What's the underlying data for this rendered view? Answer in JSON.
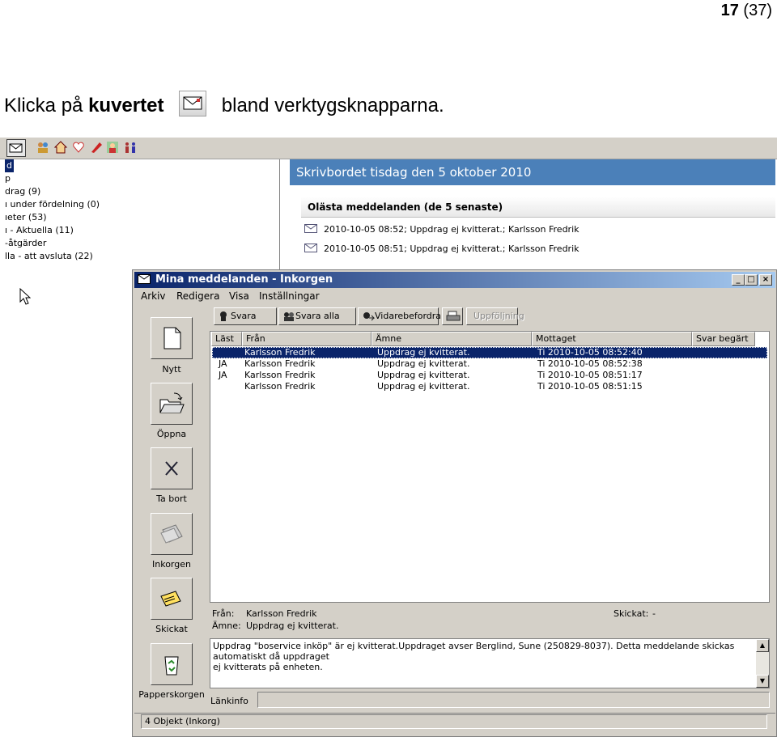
{
  "page": {
    "number": "17",
    "total": "37"
  },
  "instruction": {
    "prefix": "Klicka på",
    "bold": "kuvertet",
    "suffix": "bland verktygsknapparna."
  },
  "background_app": {
    "tree_items": [
      "d",
      "p",
      "drag (9)",
      "ı under fördelning (0)",
      "ıeter (53)",
      "ı - Aktuella (11)",
      "-åtgärder",
      "lla - att avsluta (22)"
    ],
    "desk_header": "Skrivbordet tisdag den 5 oktober 2010",
    "unread_title": "Olästa meddelanden (de 5 senaste)",
    "unread_items": [
      "2010-10-05 08:52; Uppdrag ej kvitterat.; Karlsson Fredrik",
      "2010-10-05 08:51; Uppdrag ej kvitterat.; Karlsson Fredrik"
    ]
  },
  "window": {
    "title": "Mina meddelanden - Inkorgen",
    "controls": [
      "_",
      "□",
      "×"
    ],
    "menu": [
      "Arkiv",
      "Redigera",
      "Visa",
      "Inställningar"
    ],
    "actions": {
      "reply": "Svara",
      "reply_all": "Svara alla",
      "forward": "Vidarebefordra",
      "followup": "Uppföljning"
    },
    "folders": {
      "new": "Nytt",
      "open": "Öppna",
      "delete": "Ta bort",
      "inbox": "Inkorgen",
      "sent": "Skickat",
      "trash": "Papperskorgen"
    },
    "columns": [
      "Läst",
      "Från",
      "Ämne",
      "Mottaget",
      "Svar begärt"
    ],
    "rows": [
      {
        "read": "",
        "from": "Karlsson Fredrik",
        "subject": "Uppdrag ej kvitterat.",
        "received": "Ti 2010-10-05 08:52:40",
        "reply": ""
      },
      {
        "read": "JA",
        "from": "Karlsson Fredrik",
        "subject": "Uppdrag ej kvitterat.",
        "received": "Ti 2010-10-05 08:52:38",
        "reply": ""
      },
      {
        "read": "JA",
        "from": "Karlsson Fredrik",
        "subject": "Uppdrag ej kvitterat.",
        "received": "Ti 2010-10-05 08:51:17",
        "reply": ""
      },
      {
        "read": "",
        "from": "Karlsson Fredrik",
        "subject": "Uppdrag ej kvitterat.",
        "received": "Ti 2010-10-05 08:51:15",
        "reply": ""
      }
    ],
    "preview": {
      "from_label": "Från:",
      "from_value": "Karlsson Fredrik",
      "subject_label": "Ämne:",
      "subject_value": "Uppdrag ej kvitterat.",
      "sent_label": "Skickat:",
      "sent_value": "-",
      "body_line1": "Uppdrag \"boservice inköp\" är ej kvitterat.Uppdraget avser Berglind, Sune (250829-8037). Detta meddelande skickas automatiskt då uppdraget",
      "body_line2": "ej kvitterats på enheten.",
      "link_label": "Länkinfo"
    },
    "status": "4 Objekt (Inkorg)"
  },
  "colors": {
    "titlebar_start": "#0a246a",
    "titlebar_end": "#a6caf0",
    "desk_header": "#4b80b9",
    "selection": "#0a246a",
    "window_face": "#d4d0c8"
  }
}
